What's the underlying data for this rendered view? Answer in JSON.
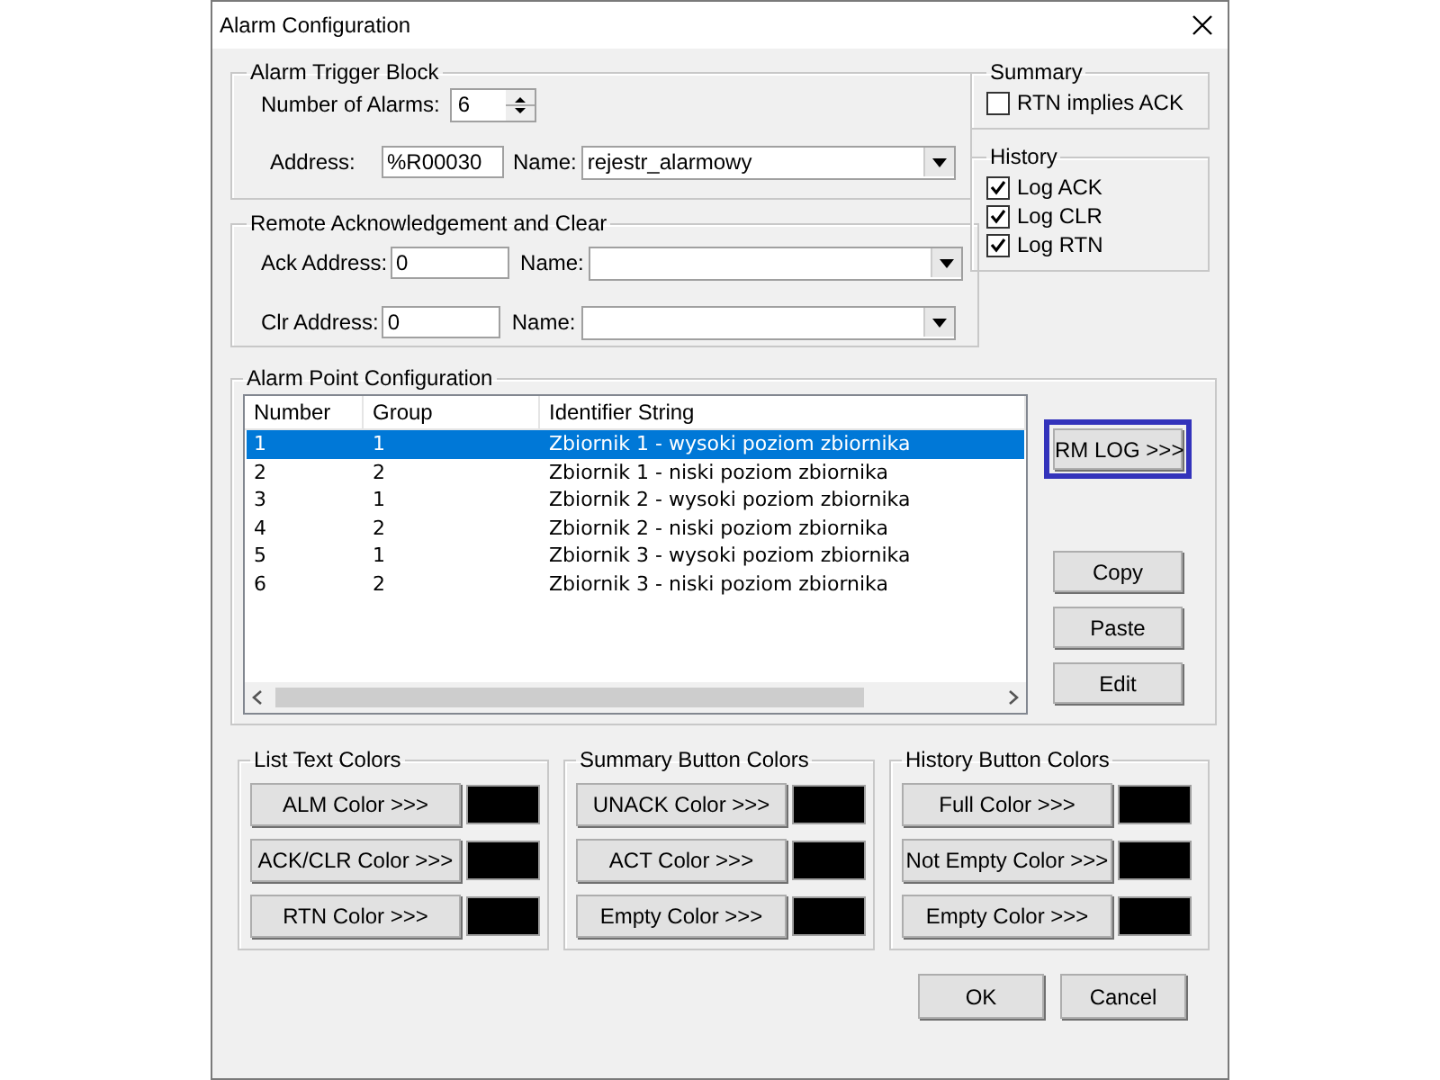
{
  "window": {
    "title": "Alarm Configuration"
  },
  "trigger_block": {
    "title": "Alarm Trigger Block",
    "count_label": "Number of Alarms:",
    "count_value": "6",
    "address_label": "Address:",
    "address_value": "%R00030",
    "name_label": "Name:",
    "name_value": "rejestr_alarmowy"
  },
  "remote": {
    "title": "Remote Acknowledgement and Clear",
    "rows": [
      {
        "address_label": "Ack Address:",
        "address_value": "0",
        "name_label": "Name:"
      },
      {
        "address_label": "Clr Address:",
        "address_value": "0",
        "name_label": "Name:"
      }
    ]
  },
  "summary": {
    "title": "Summary",
    "options": [
      {
        "label": "RTN implies ACK",
        "checked": false
      }
    ]
  },
  "history": {
    "title": "History",
    "options": [
      {
        "label": "Log ACK",
        "checked": true
      },
      {
        "label": "Log CLR",
        "checked": true
      },
      {
        "label": "Log RTN",
        "checked": true
      }
    ]
  },
  "alarm_points": {
    "title": "Alarm Point Configuration",
    "columns": [
      "Number",
      "Group",
      "Identifier String"
    ],
    "rows": [
      {
        "cells": [
          "1",
          "1",
          "Zbiornik 1 - wysoki poziom zbiornika"
        ],
        "selected": true
      },
      {
        "cells": [
          "2",
          "2",
          "Zbiornik 1 - niski poziom zbiornika"
        ],
        "selected": false
      },
      {
        "cells": [
          "3",
          "1",
          "Zbiornik 2 - wysoki poziom zbiornika"
        ],
        "selected": false
      },
      {
        "cells": [
          "4",
          "2",
          "Zbiornik 2 - niski poziom zbiornika"
        ],
        "selected": false
      },
      {
        "cells": [
          "5",
          "1",
          "Zbiornik 3 - wysoki poziom zbiornika"
        ],
        "selected": false
      },
      {
        "cells": [
          "6",
          "2",
          "Zbiornik 3 - niski poziom zbiornika"
        ],
        "selected": false
      }
    ],
    "side_buttons": [
      {
        "label": "RM LOG >>>",
        "highlighted": true
      },
      {
        "label": "Copy",
        "highlighted": false
      },
      {
        "label": "Paste",
        "highlighted": false
      },
      {
        "label": "Edit",
        "highlighted": false
      }
    ]
  },
  "color_groups": [
    {
      "title": "List Text Colors",
      "items": [
        {
          "label": "ALM Color >>>",
          "color": "#000000"
        },
        {
          "label": "ACK/CLR Color >>>",
          "color": "#000000"
        },
        {
          "label": "RTN Color >>>",
          "color": "#000000"
        }
      ]
    },
    {
      "title": "Summary Button Colors",
      "items": [
        {
          "label": "UNACK Color >>>",
          "color": "#000000"
        },
        {
          "label": "ACT Color >>>",
          "color": "#000000"
        },
        {
          "label": "Empty Color >>>",
          "color": "#000000"
        }
      ]
    },
    {
      "title": "History Button Colors",
      "items": [
        {
          "label": "Full Color >>>",
          "color": "#000000"
        },
        {
          "label": "Not Empty Color >>>",
          "color": "#000000"
        },
        {
          "label": "Empty Color >>>",
          "color": "#000000"
        }
      ]
    }
  ],
  "buttons": [
    "OK",
    "Cancel"
  ]
}
